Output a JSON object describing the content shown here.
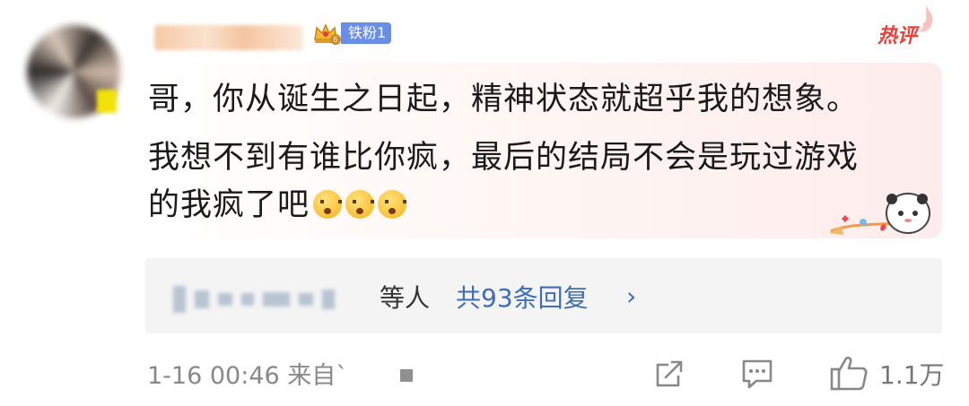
{
  "comment": {
    "fan_badge": {
      "level": "6",
      "label": "铁粉1"
    },
    "hot_badge": "热评",
    "text_lines": [
      "哥，你从诞生之日起，精神状态就超乎我的想象。",
      "我想不到有谁比你疯，最后的结局不会是玩过游戏",
      "的我疯了吧"
    ],
    "emojis": [
      "confused-face-icon",
      "confused-face-icon",
      "confused-face-icon"
    ]
  },
  "replies": {
    "etc_label": "等人",
    "count_label": "共93条回复",
    "chevron": "›"
  },
  "footer": {
    "time_source": "1-16 00:46  来自`",
    "like_count": "1.1万"
  },
  "colors": {
    "link_blue": "#3f6db7",
    "hot_red": "#ee3e37",
    "fan_badge_blue": "#6a8ee6",
    "muted_gray": "#888888"
  }
}
